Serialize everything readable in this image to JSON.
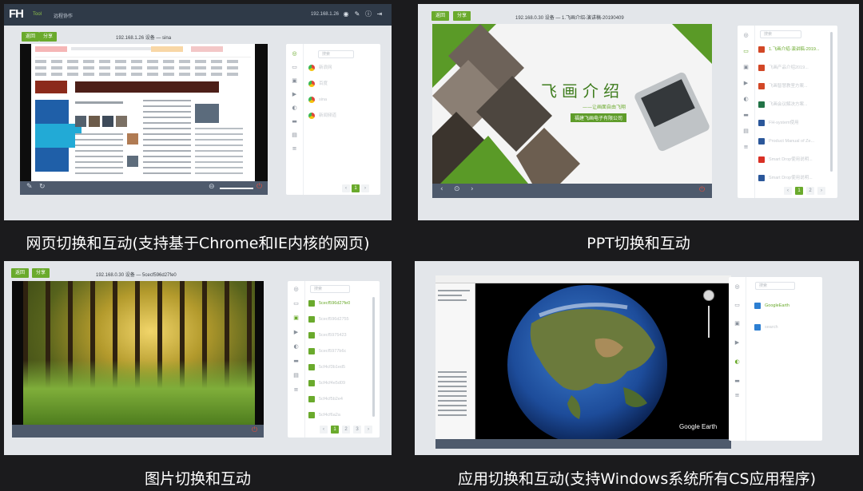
{
  "captions": {
    "web": "网页切换和互动(支持基于Chrome和IE内核的网页)",
    "ppt": "PPT切换和互动",
    "image": "图片切换和互动",
    "app": "应用切换和互动(支持Windows系统所有CS应用程序)"
  },
  "web_panel": {
    "logo": "FH",
    "logo_sub": "Tool",
    "menu": "远程协作",
    "ip": "192.168.1.26",
    "btn_back": "返回",
    "btn_share": "分享",
    "device_title": "192.168.1.26 设备 — sina",
    "search_placeholder": "搜索",
    "items": [
      "新浪网",
      "百度",
      "sina",
      "新闻频道"
    ],
    "pages": [
      "1"
    ]
  },
  "ppt_panel": {
    "btn_back": "返回",
    "btn_share": "分享",
    "device_title": "192.168.0.30 设备 — 1.飞画介绍-演讲稿-20190409",
    "slide_title": "飞画介绍",
    "slide_sub": "——让画面自由飞翔",
    "slide_company": "福建飞画电子有限公司",
    "search_placeholder": "搜索",
    "items": [
      "1.飞画介绍-演讲稿-2019...",
      "飞画产品介绍2019...",
      "飞画智慧教室方案...",
      "飞画会议解决方案...",
      "FH-system使用",
      "Product Manual of Ze...",
      "Smart Drop使用说明...",
      "Smart Drop使用说明...",
      "Smart Drop说明书..."
    ],
    "pages": [
      "1",
      "2"
    ]
  },
  "image_panel": {
    "btn_back": "返回",
    "btn_share": "分享",
    "device_title": "192.168.0.30 设备 — 5cecf596d27fe0",
    "search_placeholder": "搜索",
    "items": [
      "5cecf596d27fe0",
      "5cecf596d2755",
      "5cecf5975423",
      "5cecf5977b6c",
      "5cf4cf3b1ed5",
      "5cf4cf4e5d09",
      "5cf4cf5b2e4",
      "5cf4cf6a2a"
    ],
    "pages": [
      "1",
      "2",
      "3"
    ]
  },
  "app_panel": {
    "search_placeholder": "搜索",
    "items": [
      "GoogleEarth",
      "search"
    ],
    "earth_brand": "Google Earth"
  },
  "colors": {
    "accent": "#6aaa2c",
    "topbar": "#2f3a48",
    "ctrl": "#4e5a6c"
  }
}
